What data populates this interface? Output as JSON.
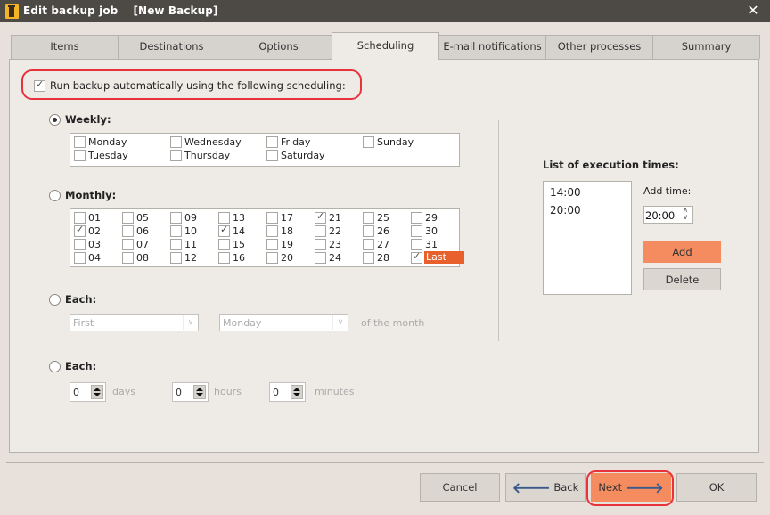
{
  "window": {
    "title": "Edit backup job    [New Backup]",
    "close_glyph": "✕"
  },
  "tabs": [
    {
      "label": "Items",
      "active": false
    },
    {
      "label": "Destinations",
      "active": false
    },
    {
      "label": "Options",
      "active": false
    },
    {
      "label": "Scheduling",
      "active": true
    },
    {
      "label": "E-mail notifications",
      "active": false
    },
    {
      "label": "Other processes",
      "active": false
    },
    {
      "label": "Summary",
      "active": false
    }
  ],
  "scheduling": {
    "run_auto": {
      "label": "Run backup automatically using the following scheduling:",
      "checked": true
    },
    "weekly": {
      "label": "Weekly:",
      "selected": true,
      "days": [
        {
          "label": "Monday",
          "checked": false
        },
        {
          "label": "Tuesday",
          "checked": false
        },
        {
          "label": "Wednesday",
          "checked": false
        },
        {
          "label": "Thursday",
          "checked": false
        },
        {
          "label": "Friday",
          "checked": false
        },
        {
          "label": "Saturday",
          "checked": false
        },
        {
          "label": "Sunday",
          "checked": false
        }
      ]
    },
    "monthly": {
      "label": "Monthly:",
      "selected": false,
      "days": [
        {
          "label": "01",
          "checked": false
        },
        {
          "label": "02",
          "checked": true
        },
        {
          "label": "03",
          "checked": false
        },
        {
          "label": "04",
          "checked": false
        },
        {
          "label": "05",
          "checked": false
        },
        {
          "label": "06",
          "checked": false
        },
        {
          "label": "07",
          "checked": false
        },
        {
          "label": "08",
          "checked": false
        },
        {
          "label": "09",
          "checked": false
        },
        {
          "label": "10",
          "checked": false
        },
        {
          "label": "11",
          "checked": false
        },
        {
          "label": "12",
          "checked": false
        },
        {
          "label": "13",
          "checked": false
        },
        {
          "label": "14",
          "checked": true
        },
        {
          "label": "15",
          "checked": false
        },
        {
          "label": "16",
          "checked": false
        },
        {
          "label": "17",
          "checked": false
        },
        {
          "label": "18",
          "checked": false
        },
        {
          "label": "19",
          "checked": false
        },
        {
          "label": "20",
          "checked": false
        },
        {
          "label": "21",
          "checked": true
        },
        {
          "label": "22",
          "checked": false
        },
        {
          "label": "23",
          "checked": false
        },
        {
          "label": "24",
          "checked": false
        },
        {
          "label": "25",
          "checked": false
        },
        {
          "label": "26",
          "checked": false
        },
        {
          "label": "27",
          "checked": false
        },
        {
          "label": "28",
          "checked": false
        },
        {
          "label": "29",
          "checked": false
        },
        {
          "label": "30",
          "checked": false
        },
        {
          "label": "31",
          "checked": false
        },
        {
          "label": "Last",
          "checked": true,
          "highlighted": true
        }
      ]
    },
    "each_of_month": {
      "label": "Each:",
      "selected": false,
      "ordinal": "First",
      "weekday": "Monday",
      "suffix": "of the month"
    },
    "each_interval": {
      "label": "Each:",
      "selected": false,
      "days": {
        "value": "0",
        "unit": "days"
      },
      "hours": {
        "value": "0",
        "unit": "hours"
      },
      "minutes": {
        "value": "0",
        "unit": "minutes"
      }
    },
    "execution_times": {
      "title": "List of execution times:",
      "items": [
        "14:00",
        "20:00"
      ],
      "add_time_label": "Add time:",
      "add_time_value": "20:00",
      "add_label": "Add",
      "delete_label": "Delete"
    }
  },
  "footer": {
    "cancel": "Cancel",
    "back": "Back",
    "next": "Next",
    "ok": "OK",
    "back_arrow": "🡐",
    "next_arrow": "🡒"
  },
  "colors": {
    "accent_orange": "#f48c5f",
    "highlight_orange": "#e8612c",
    "annotation_red": "#e8333c",
    "titlebar": "#4d4a45"
  }
}
